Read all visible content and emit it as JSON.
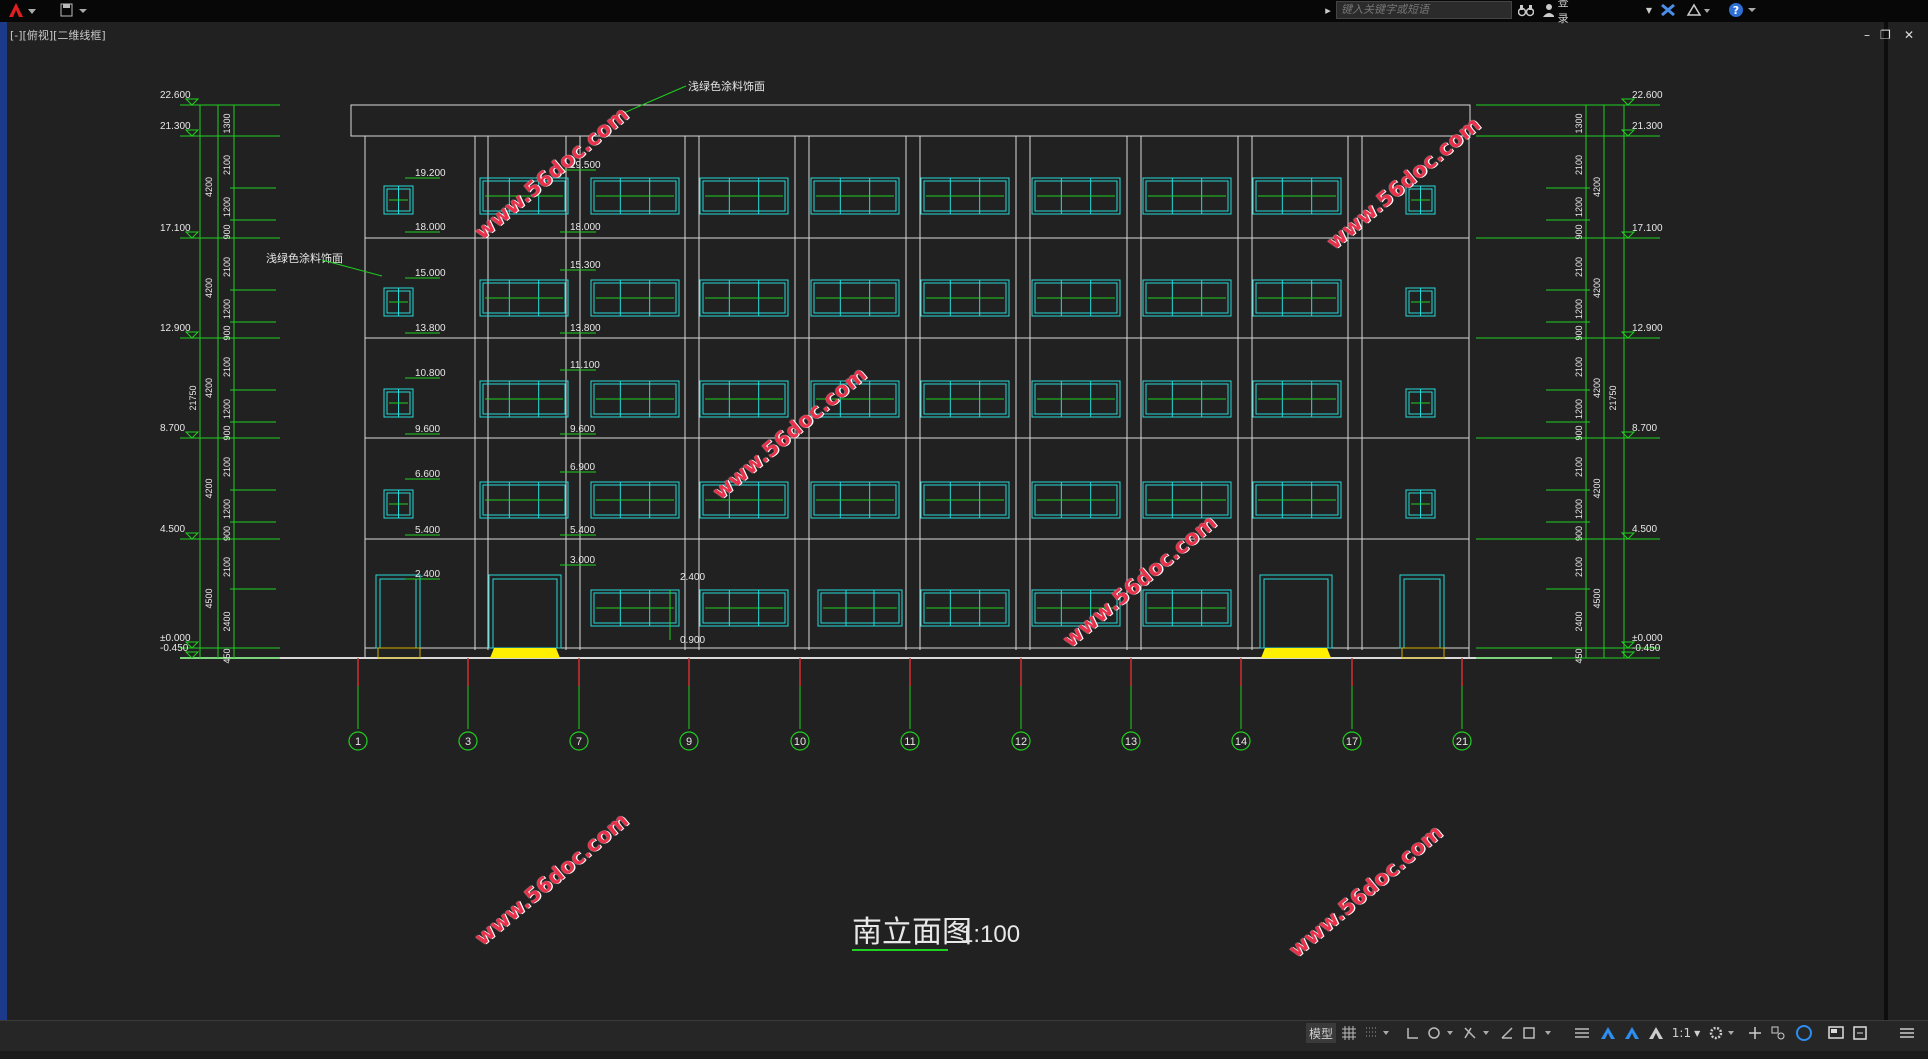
{
  "app": {
    "search_placeholder": "键入关键字或短语",
    "login_label": "登录",
    "viewport_label": "[-][俯视][二维线框]"
  },
  "drawing": {
    "title": "南立面图",
    "scale": "1:100",
    "notes": [
      "浅绿色涂料饰面",
      "浅绿色涂料饰面"
    ],
    "grid_axes": [
      "1",
      "3",
      "7",
      "9",
      "10",
      "11",
      "12",
      "13",
      "14",
      "17",
      "21"
    ],
    "left_levels": [
      "22.600",
      "21.300",
      "17.100",
      "12.900",
      "8.700",
      "4.500",
      "±0.000",
      "-0.450"
    ],
    "right_levels": [
      "22.600",
      "21.300",
      "17.100",
      "12.900",
      "8.700",
      "4.500",
      "±0.000",
      "-0.450"
    ],
    "left_dims_inner": [
      "1300",
      "2100",
      "1200",
      "900",
      "2100",
      "1200",
      "900",
      "2100",
      "1200",
      "900",
      "2100",
      "1200",
      "900",
      "2100",
      "2400",
      "450"
    ],
    "left_dims_outer": [
      "4200",
      "4200",
      "4200",
      "4200",
      "4500"
    ],
    "total_height": "21750",
    "window_levels_a": [
      "19.200",
      "18.000",
      "15.000",
      "13.800",
      "10.800",
      "9.600",
      "6.600",
      "5.400",
      "2.400"
    ],
    "window_levels_b": [
      "19.500",
      "18.000",
      "15.300",
      "13.800",
      "11.100",
      "9.600",
      "6.900",
      "5.400",
      "3.000"
    ],
    "window_levels_c": [
      "2.400",
      "0.900"
    ]
  },
  "watermark_text": "www.56doc.com",
  "status": {
    "model_label": "模型",
    "scale_label": "1:1"
  },
  "colors": {
    "background": "#212121",
    "building_line": "#d9d9d9",
    "window": "#27d9d9",
    "dimension": "#20d020",
    "axis_line": "#d03030",
    "accent": "#ffef00"
  }
}
